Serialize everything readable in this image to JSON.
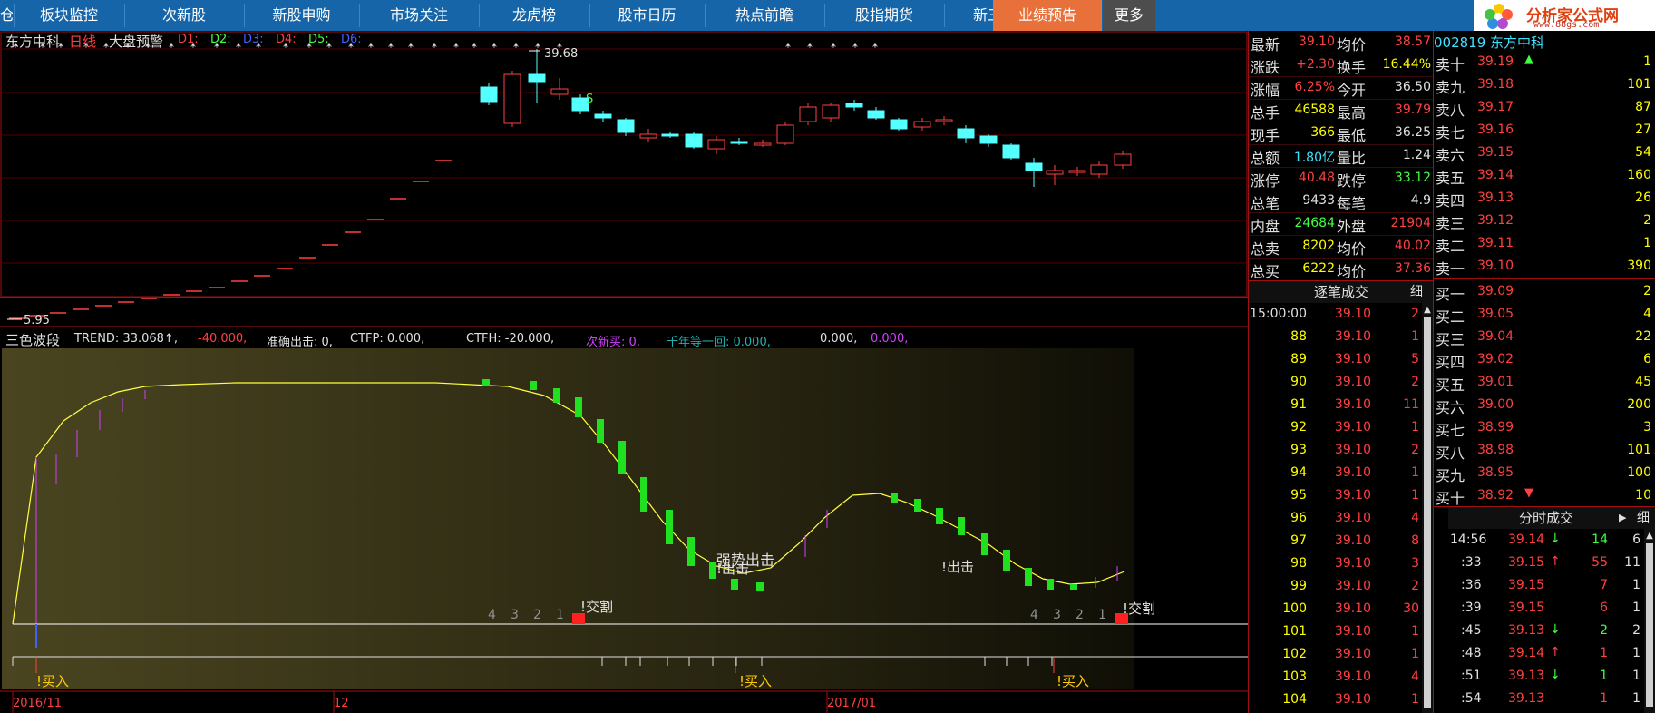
{
  "nav": {
    "items": [
      "板块监控",
      "次新股",
      "新股申购",
      "市场关注",
      "龙虎榜",
      "股市日历",
      "热点前瞻",
      "股指期货",
      "新三板",
      "业绩预告",
      "更多"
    ],
    "left_partial": "仓",
    "logo_title": "分析家公式网",
    "logo_url": "www.88gs.com"
  },
  "chart_header": {
    "stock_name": "东方中科",
    "period": "日线",
    "alert": "大盘预警",
    "d_labels": [
      "D1:",
      "D2:",
      "D3:",
      "D4:",
      "D5:",
      "D6:"
    ]
  },
  "kline": {
    "high_label": "39.68",
    "low_label": "5.95",
    "s_mark": "S"
  },
  "indicator": {
    "name": "三色波段",
    "trend_label": "TREND: 33.068↑,",
    "neg_value": "-40.000,",
    "zhunque": "准确出击: 0,",
    "ctfp": "CTFP: 0.000,",
    "ctfh": "CTFH: -20.000,",
    "cixinmai": "次新买: 0,",
    "qiannian": "千年等一回: 0.000,",
    "v1": "0.000,",
    "v2": "0.000,"
  },
  "annotations": {
    "buy": "!买入",
    "sell": "!出击",
    "strong": "强势出击",
    "jiaoge": "!交割",
    "countdown": [
      "4",
      "3",
      "2",
      "1"
    ]
  },
  "x_axis": [
    "2016/11",
    "12",
    "2017/01"
  ],
  "quote": {
    "rows": [
      {
        "k1": "最新",
        "v1": "39.10",
        "c1": "#ff4040",
        "k2": "均价",
        "v2": "38.57",
        "c2": "#ff4040"
      },
      {
        "k1": "涨跌",
        "v1": "+2.30",
        "c1": "#ff4040",
        "k2": "换手",
        "v2": "16.44%",
        "c2": "#ffff00"
      },
      {
        "k1": "涨幅",
        "v1": "6.25%",
        "c1": "#ff4040",
        "k2": "今开",
        "v2": "36.50",
        "c2": "#e0e0e0"
      },
      {
        "k1": "总手",
        "v1": "46588",
        "c1": "#ffff00",
        "k2": "最高",
        "v2": "39.79",
        "c2": "#ff4040"
      },
      {
        "k1": "现手",
        "v1": "366",
        "c1": "#ffff00",
        "k2": "最低",
        "v2": "36.25",
        "c2": "#e0e0e0"
      },
      {
        "k1": "总额",
        "v1": "1.80亿",
        "c1": "#40e0ff",
        "k2": "量比",
        "v2": "1.24",
        "c2": "#e0e0e0"
      },
      {
        "k1": "涨停",
        "v1": "40.48",
        "c1": "#ff4040",
        "k2": "跌停",
        "v2": "33.12",
        "c2": "#40ff40"
      },
      {
        "k1": "总笔",
        "v1": "9433",
        "c1": "#e0e0e0",
        "k2": "每笔",
        "v2": "4.9",
        "c2": "#e0e0e0"
      },
      {
        "k1": "内盘",
        "v1": "24684",
        "c1": "#40ff40",
        "k2": "外盘",
        "v2": "21904",
        "c2": "#ff4040"
      },
      {
        "k1": "总卖",
        "v1": "8202",
        "c1": "#ffff00",
        "k2": "均价",
        "v2": "40.02",
        "c2": "#ff4040"
      },
      {
        "k1": "总买",
        "v1": "6222",
        "c1": "#ffff00",
        "k2": "均价",
        "v2": "37.36",
        "c2": "#ff4040"
      }
    ]
  },
  "trades_panel": {
    "title": "逐笔成交",
    "detail": "细",
    "rows": [
      {
        "t": "15:00:00",
        "p": "39.10",
        "v": "2"
      },
      {
        "t": "88",
        "p": "39.10",
        "v": "1"
      },
      {
        "t": "89",
        "p": "39.10",
        "v": "5"
      },
      {
        "t": "90",
        "p": "39.10",
        "v": "2"
      },
      {
        "t": "91",
        "p": "39.10",
        "v": "11"
      },
      {
        "t": "92",
        "p": "39.10",
        "v": "1"
      },
      {
        "t": "93",
        "p": "39.10",
        "v": "2"
      },
      {
        "t": "94",
        "p": "39.10",
        "v": "1"
      },
      {
        "t": "95",
        "p": "39.10",
        "v": "1"
      },
      {
        "t": "96",
        "p": "39.10",
        "v": "4"
      },
      {
        "t": "97",
        "p": "39.10",
        "v": "8"
      },
      {
        "t": "98",
        "p": "39.10",
        "v": "3"
      },
      {
        "t": "99",
        "p": "39.10",
        "v": "2"
      },
      {
        "t": "100",
        "p": "39.10",
        "v": "30"
      },
      {
        "t": "101",
        "p": "39.10",
        "v": "1"
      },
      {
        "t": "102",
        "p": "39.10",
        "v": "1"
      },
      {
        "t": "103",
        "p": "39.10",
        "v": "4"
      },
      {
        "t": "104",
        "p": "39.10",
        "v": "1"
      }
    ]
  },
  "orderbook": {
    "header_partial": "002819 东方中科",
    "sell": [
      {
        "k": "卖十",
        "p": "39.19",
        "v": "1",
        "c": "#ff4040"
      },
      {
        "k": "卖九",
        "p": "39.18",
        "v": "101",
        "c": "#ff4040"
      },
      {
        "k": "卖八",
        "p": "39.17",
        "v": "87",
        "c": "#ff4040"
      },
      {
        "k": "卖七",
        "p": "39.16",
        "v": "27",
        "c": "#ff4040"
      },
      {
        "k": "卖六",
        "p": "39.15",
        "v": "54",
        "c": "#ff4040"
      },
      {
        "k": "卖五",
        "p": "39.14",
        "v": "160",
        "c": "#ff4040"
      },
      {
        "k": "卖四",
        "p": "39.13",
        "v": "26",
        "c": "#ff4040"
      },
      {
        "k": "卖三",
        "p": "39.12",
        "v": "2",
        "c": "#ff4040"
      },
      {
        "k": "卖二",
        "p": "39.11",
        "v": "1",
        "c": "#ff4040"
      },
      {
        "k": "卖一",
        "p": "39.10",
        "v": "390",
        "c": "#ff4040"
      }
    ],
    "buy": [
      {
        "k": "买一",
        "p": "39.09",
        "v": "2",
        "c": "#ff4040"
      },
      {
        "k": "买二",
        "p": "39.05",
        "v": "4",
        "c": "#ff4040"
      },
      {
        "k": "买三",
        "p": "39.04",
        "v": "22",
        "c": "#ff4040"
      },
      {
        "k": "买四",
        "p": "39.02",
        "v": "6",
        "c": "#ff4040"
      },
      {
        "k": "买五",
        "p": "39.01",
        "v": "45",
        "c": "#ff4040"
      },
      {
        "k": "买六",
        "p": "39.00",
        "v": "200",
        "c": "#ff4040"
      },
      {
        "k": "买七",
        "p": "38.99",
        "v": "3",
        "c": "#ff4040"
      },
      {
        "k": "买八",
        "p": "38.98",
        "v": "101",
        "c": "#ff4040"
      },
      {
        "k": "买九",
        "p": "38.95",
        "v": "100",
        "c": "#ff4040"
      },
      {
        "k": "买十",
        "p": "38.92",
        "v": "10",
        "c": "#ff4040"
      }
    ]
  },
  "timeshare": {
    "title": "分时成交",
    "detail": "细",
    "rows": [
      {
        "t": "14:56",
        "p": "39.14",
        "a": "↓",
        "v": "14",
        "n": "6",
        "vc": "#40ff40"
      },
      {
        "t": ":33",
        "p": "39.15",
        "a": "↑",
        "v": "55",
        "n": "11",
        "vc": "#ff4040"
      },
      {
        "t": ":36",
        "p": "39.15",
        "a": "",
        "v": "7",
        "n": "1",
        "vc": "#ff4040"
      },
      {
        "t": ":39",
        "p": "39.15",
        "a": "",
        "v": "6",
        "n": "1",
        "vc": "#ff4040"
      },
      {
        "t": ":45",
        "p": "39.13",
        "a": "↓",
        "v": "2",
        "n": "2",
        "vc": "#40ff40"
      },
      {
        "t": ":48",
        "p": "39.14",
        "a": "↑",
        "v": "1",
        "n": "1",
        "vc": "#ff4040"
      },
      {
        "t": ":51",
        "p": "39.13",
        "a": "↓",
        "v": "1",
        "n": "1",
        "vc": "#40ff40"
      },
      {
        "t": ":54",
        "p": "39.13",
        "a": "",
        "v": "1",
        "n": "1",
        "vc": "#ff4040"
      }
    ]
  },
  "colors": {
    "nav_bg": "#1565a8",
    "nav_active": "#e8703a",
    "up": "#ff4040",
    "down": "#40ff40",
    "cyan": "#54ffff"
  }
}
